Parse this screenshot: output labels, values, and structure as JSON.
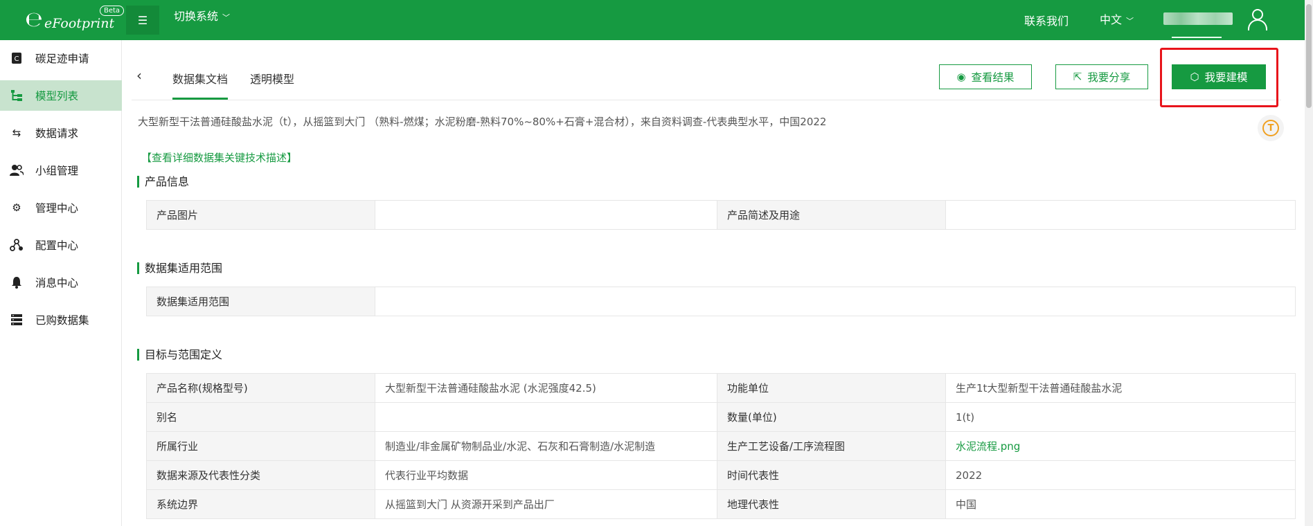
{
  "header": {
    "logo_text": "eFootprint",
    "beta_badge": "Beta",
    "switch_system": "切换系统",
    "contact": "联系我们",
    "language": "中文"
  },
  "sidebar": {
    "items": [
      {
        "label": "碳足迹申请",
        "icon": "footprint-doc-icon"
      },
      {
        "label": "模型列表",
        "icon": "tree-list-icon",
        "active": true
      },
      {
        "label": "数据请求",
        "icon": "swap-arrows-icon"
      },
      {
        "label": "小组管理",
        "icon": "group-users-icon"
      },
      {
        "label": "管理中心",
        "icon": "gear-icon"
      },
      {
        "label": "配置中心",
        "icon": "cluster-icon"
      },
      {
        "label": "消息中心",
        "icon": "bell-icon"
      },
      {
        "label": "已购数据集",
        "icon": "server-stack-icon"
      }
    ]
  },
  "tabs": {
    "dataset_doc": "数据集文档",
    "transparent_model": "透明模型"
  },
  "actions": {
    "view_results": "查看结果",
    "share": "我要分享",
    "build_model": "我要建模"
  },
  "description": "大型新型干法普通硅酸盐水泥（t），从摇篮到大门 （熟料-燃煤；水泥粉磨-熟料70%~80%+石膏+混合材），来自资料调查-代表典型水平，中国2022",
  "detail_link": "【查看详细数据集关键技术描述】",
  "product_info": {
    "title": "产品信息",
    "image_label": "产品图片",
    "image_value": "",
    "summary_label": "产品简述及用途",
    "summary_value": ""
  },
  "scope": {
    "title": "数据集适用范围",
    "label": "数据集适用范围",
    "value": ""
  },
  "goal": {
    "title": "目标与范围定义",
    "rows": [
      {
        "k1": "产品名称(规格型号)",
        "v1": "大型新型干法普通硅酸盐水泥 (水泥强度42.5)",
        "k2": "功能单位",
        "v2": "生产1t大型新型干法普通硅酸盐水泥"
      },
      {
        "k1": "别名",
        "v1": "",
        "k2": "数量(单位)",
        "v2": "1(t)"
      },
      {
        "k1": "所属行业",
        "v1": "制造业/非金属矿物制品业/水泥、石灰和石膏制造/水泥制造",
        "k2": "生产工艺设备/工序流程图",
        "v2": "水泥流程.png"
      },
      {
        "k1": "数据来源及代表性分类",
        "v1": "代表行业平均数据",
        "k2": "时间代表性",
        "v2": "2022"
      },
      {
        "k1": "系统边界",
        "v1": "从摇篮到大门 从资源开采到产品出厂",
        "k2": "地理代表性",
        "v2": "中国"
      }
    ]
  },
  "colors": {
    "brand": "#169a41",
    "highlight": "#e8141b"
  }
}
